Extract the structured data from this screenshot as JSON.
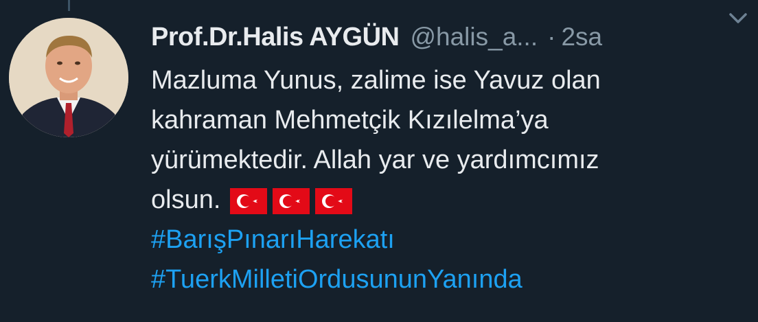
{
  "tweet": {
    "display_name": "Prof.Dr.Halis AYGÜN",
    "handle": "@halis_a...",
    "separator": "·",
    "time": "2sa",
    "text_lines": [
      "Mazluma Yunus, zalime ise Yavuz olan",
      "kahraman Mehmetçik Kızılelma’ya",
      "yürümektedir. Allah yar ve yardımcımız",
      "olsun."
    ],
    "emoji": [
      "turkey-flag",
      "turkey-flag",
      "turkey-flag"
    ],
    "hashtags": [
      "#BarışPınarıHarekatı",
      "#TuerkMilletiOrdusununYanında"
    ]
  },
  "colors": {
    "background": "#15202b",
    "text": "#e8ebee",
    "muted": "#8899a6",
    "link": "#1da1f2",
    "flag_red": "#e30a17"
  },
  "icons": {
    "menu": "chevron-down-icon"
  }
}
